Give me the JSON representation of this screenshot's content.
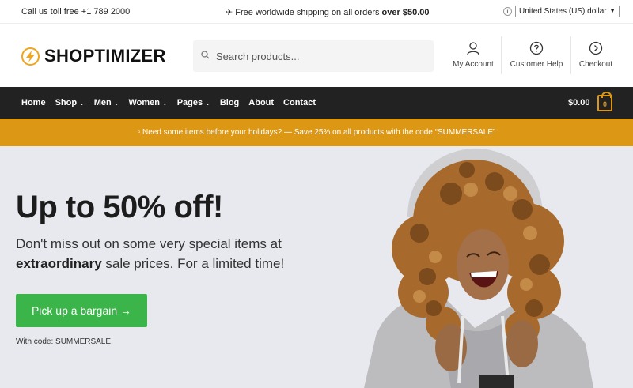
{
  "topbar": {
    "phone_text": "Call us toll free +1 789 2000",
    "shipping_prefix": "✈ Free worldwide shipping on all orders ",
    "shipping_amount": "over $50.00",
    "currency": "United States (US) dollar"
  },
  "header": {
    "logo_text": "SHOPTIMIZER",
    "search_placeholder": "Search products...",
    "links": [
      {
        "label": "My Account",
        "icon": "user-icon"
      },
      {
        "label": "Customer Help",
        "icon": "help-icon"
      },
      {
        "label": "Checkout",
        "icon": "arrow-right-circle-icon"
      }
    ]
  },
  "nav": {
    "items": [
      {
        "label": "Home",
        "dropdown": false
      },
      {
        "label": "Shop",
        "dropdown": true
      },
      {
        "label": "Men",
        "dropdown": true
      },
      {
        "label": "Women",
        "dropdown": true
      },
      {
        "label": "Pages",
        "dropdown": true
      },
      {
        "label": "Blog",
        "dropdown": false
      },
      {
        "label": "About",
        "dropdown": false
      },
      {
        "label": "Contact",
        "dropdown": false
      }
    ],
    "cart_total": "$0.00",
    "cart_count": "0"
  },
  "promo": {
    "text": "▫ Need some items before your holidays? — Save 25% on all products with the code “SUMMERSALE”"
  },
  "hero": {
    "headline": "Up to 50% off!",
    "sub_line1": "Don't miss out on some very special items at ",
    "sub_bold": "extraordinary",
    "sub_line2": " sale prices. For a limited time!",
    "cta_label": "Pick up a bargain →",
    "code_note": "With code: SUMMERSALE"
  },
  "colors": {
    "accent": "#dc9814",
    "nav_bg": "#222222",
    "cta_green": "#3bb54a",
    "hero_bg": "#e7e9ee"
  }
}
